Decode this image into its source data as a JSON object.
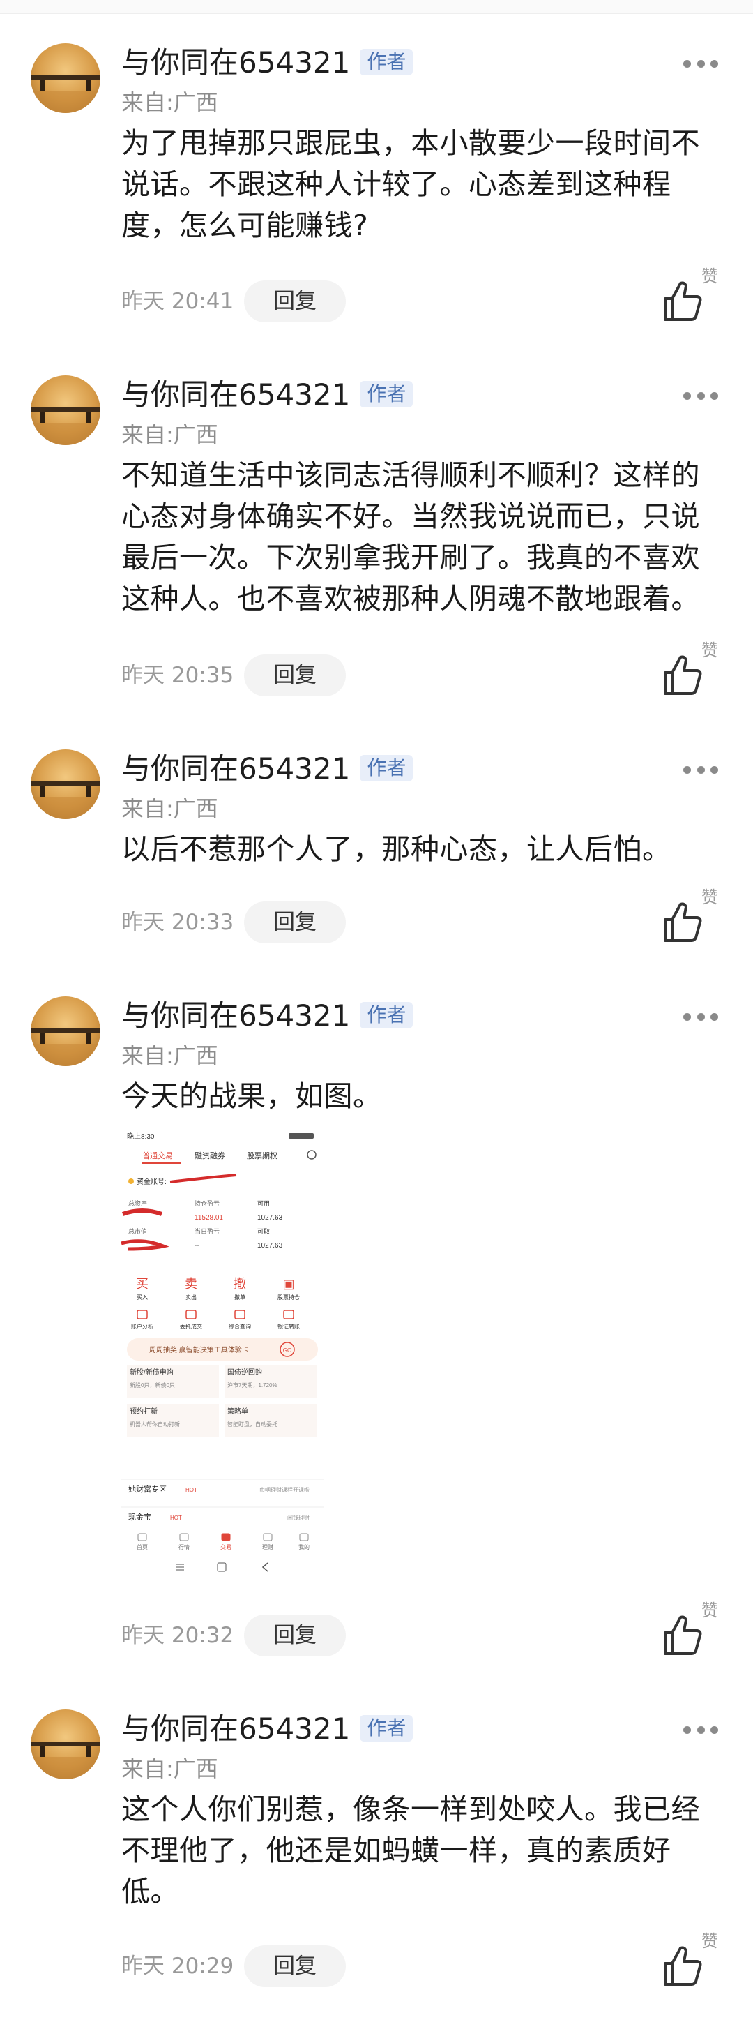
{
  "comments": [
    {
      "user": "与你同在654321",
      "badge": "作者",
      "location": "来自:广西",
      "text": "为了甩掉那只跟屁虫，本小散要少一段时间不说话。不跟这种人计较了。心态差到这种程度，怎么可能赚钱?",
      "time": "昨天 20:41",
      "reply_label": "回复",
      "like_label": "赞"
    },
    {
      "user": "与你同在654321",
      "badge": "作者",
      "location": "来自:广西",
      "text": "不知道生活中该同志活得顺利不顺利？这样的心态对身体确实不好。当然我说说而已，只说最后一次。下次别拿我开刷了。我真的不喜欢这种人。也不喜欢被那种人阴魂不散地跟着。",
      "time": "昨天 20:35",
      "reply_label": "回复",
      "like_label": "赞"
    },
    {
      "user": "与你同在654321",
      "badge": "作者",
      "location": "来自:广西",
      "text": "以后不惹那个人了，那种心态，让人后怕。",
      "time": "昨天 20:33",
      "reply_label": "回复",
      "like_label": "赞"
    },
    {
      "user": "与你同在654321",
      "badge": "作者",
      "location": "来自:广西",
      "text": "今天的战果，如图。",
      "time": "昨天 20:32",
      "reply_label": "回复",
      "like_label": "赞"
    },
    {
      "user": "与你同在654321",
      "badge": "作者",
      "location": "来自:广西",
      "text": "这个人你们别惹，像条一样到处咬人。我已经不理他了，他还是如蚂蟥一样，真的素质好低。",
      "time": "昨天 20:29",
      "reply_label": "回复",
      "like_label": "赞"
    }
  ],
  "screenshot": {
    "status_time": "晚上8:30",
    "tabs": [
      "普通交易",
      "融资融券",
      "股票期权"
    ],
    "account_label": "资金账号:",
    "rows": [
      {
        "c1": "总资产",
        "c2": "持仓盈亏",
        "c3": "可用"
      },
      {
        "c1": "",
        "c2": "11528.01",
        "c3": "1027.63"
      },
      {
        "c1": "总市值",
        "c2": "当日盈亏",
        "c3": "可取"
      },
      {
        "c1": "",
        "c2": "--",
        "c3": "1027.63"
      }
    ],
    "actions": [
      {
        "big": "买",
        "small": "买入",
        "color": "#e0463a"
      },
      {
        "big": "卖",
        "small": "卖出",
        "color": "#e0463a"
      },
      {
        "big": "撤",
        "small": "撤单",
        "color": "#e0463a"
      },
      {
        "big": "▣",
        "small": "股票持仓",
        "color": "#e0463a"
      }
    ],
    "actions2": [
      "账户分析",
      "委托成交",
      "综合查询",
      "银证转账"
    ],
    "banner": "周周抽奖 赢智能决策工具体验卡",
    "banner_go": "GO",
    "cards": [
      {
        "title": "新股/新债申购",
        "sub": "新股0只，新债0只"
      },
      {
        "title": "国债逆回购",
        "sub": "沪市7天期，1.720%"
      },
      {
        "title": "预约打新",
        "sub": "机器人帮你自动打新"
      },
      {
        "title": "策略单",
        "sub": "智能盯盘，自动委托"
      }
    ],
    "list": [
      {
        "title": "她财富专区",
        "tag": "HOT",
        "right": "巾帼理财课程开课啦"
      },
      {
        "title": "现金宝",
        "tag": "HOT",
        "right": "闲钱理财"
      }
    ],
    "nav": [
      "首页",
      "行情",
      "交易",
      "理财",
      "我的"
    ]
  },
  "colors": {
    "badge_bg": "#e8eef9",
    "badge_text": "#4a72b2",
    "accent_red": "#e0463a"
  }
}
